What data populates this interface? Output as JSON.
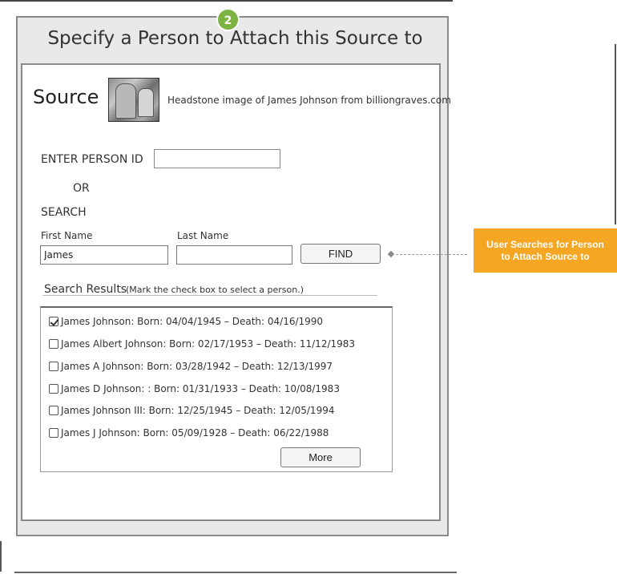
{
  "step_badge": "2",
  "dialog": {
    "title": "Specify a Person to Attach this Source to"
  },
  "source": {
    "heading": "Source",
    "image_icon": "headstone-image",
    "description": "Headstone image of James Johnson from billiongraves.com"
  },
  "person_id": {
    "label": "ENTER PERSON ID",
    "value": ""
  },
  "or_label": "OR",
  "search": {
    "label": "SEARCH",
    "first_name_label": "First Name",
    "first_name_value": "James",
    "last_name_label": "Last Name",
    "last_name_value": "",
    "find_label": "FIND"
  },
  "results": {
    "heading": "Search Results",
    "hint": "(Mark the check box to select a person.)",
    "items": [
      {
        "text": "James Johnson: Born: 04/04/1945 – Death: 04/16/1990",
        "checked": true
      },
      {
        "text": "James Albert Johnson: Born: 02/17/1953 – Death: 11/12/1983",
        "checked": false
      },
      {
        "text": "James A Johnson: Born: 03/28/1942 – Death: 12/13/1997",
        "checked": false
      },
      {
        "text": "James D Johnson: : Born: 01/31/1933 – Death: 10/08/1983",
        "checked": false
      },
      {
        "text": "James Johnson III: Born: 12/25/1945 – Death: 12/05/1994",
        "checked": false
      },
      {
        "text": "James J Johnson: Born: 05/09/1928 – Death: 06/22/1988",
        "checked": false
      }
    ],
    "more_label": "More"
  },
  "annotation": {
    "line1": "User Searches for Person",
    "line2": "to Attach Source to",
    "color": "#f5a623"
  },
  "colors": {
    "badge": "#7cb342",
    "dialog_bg": "#e9e9e9"
  }
}
